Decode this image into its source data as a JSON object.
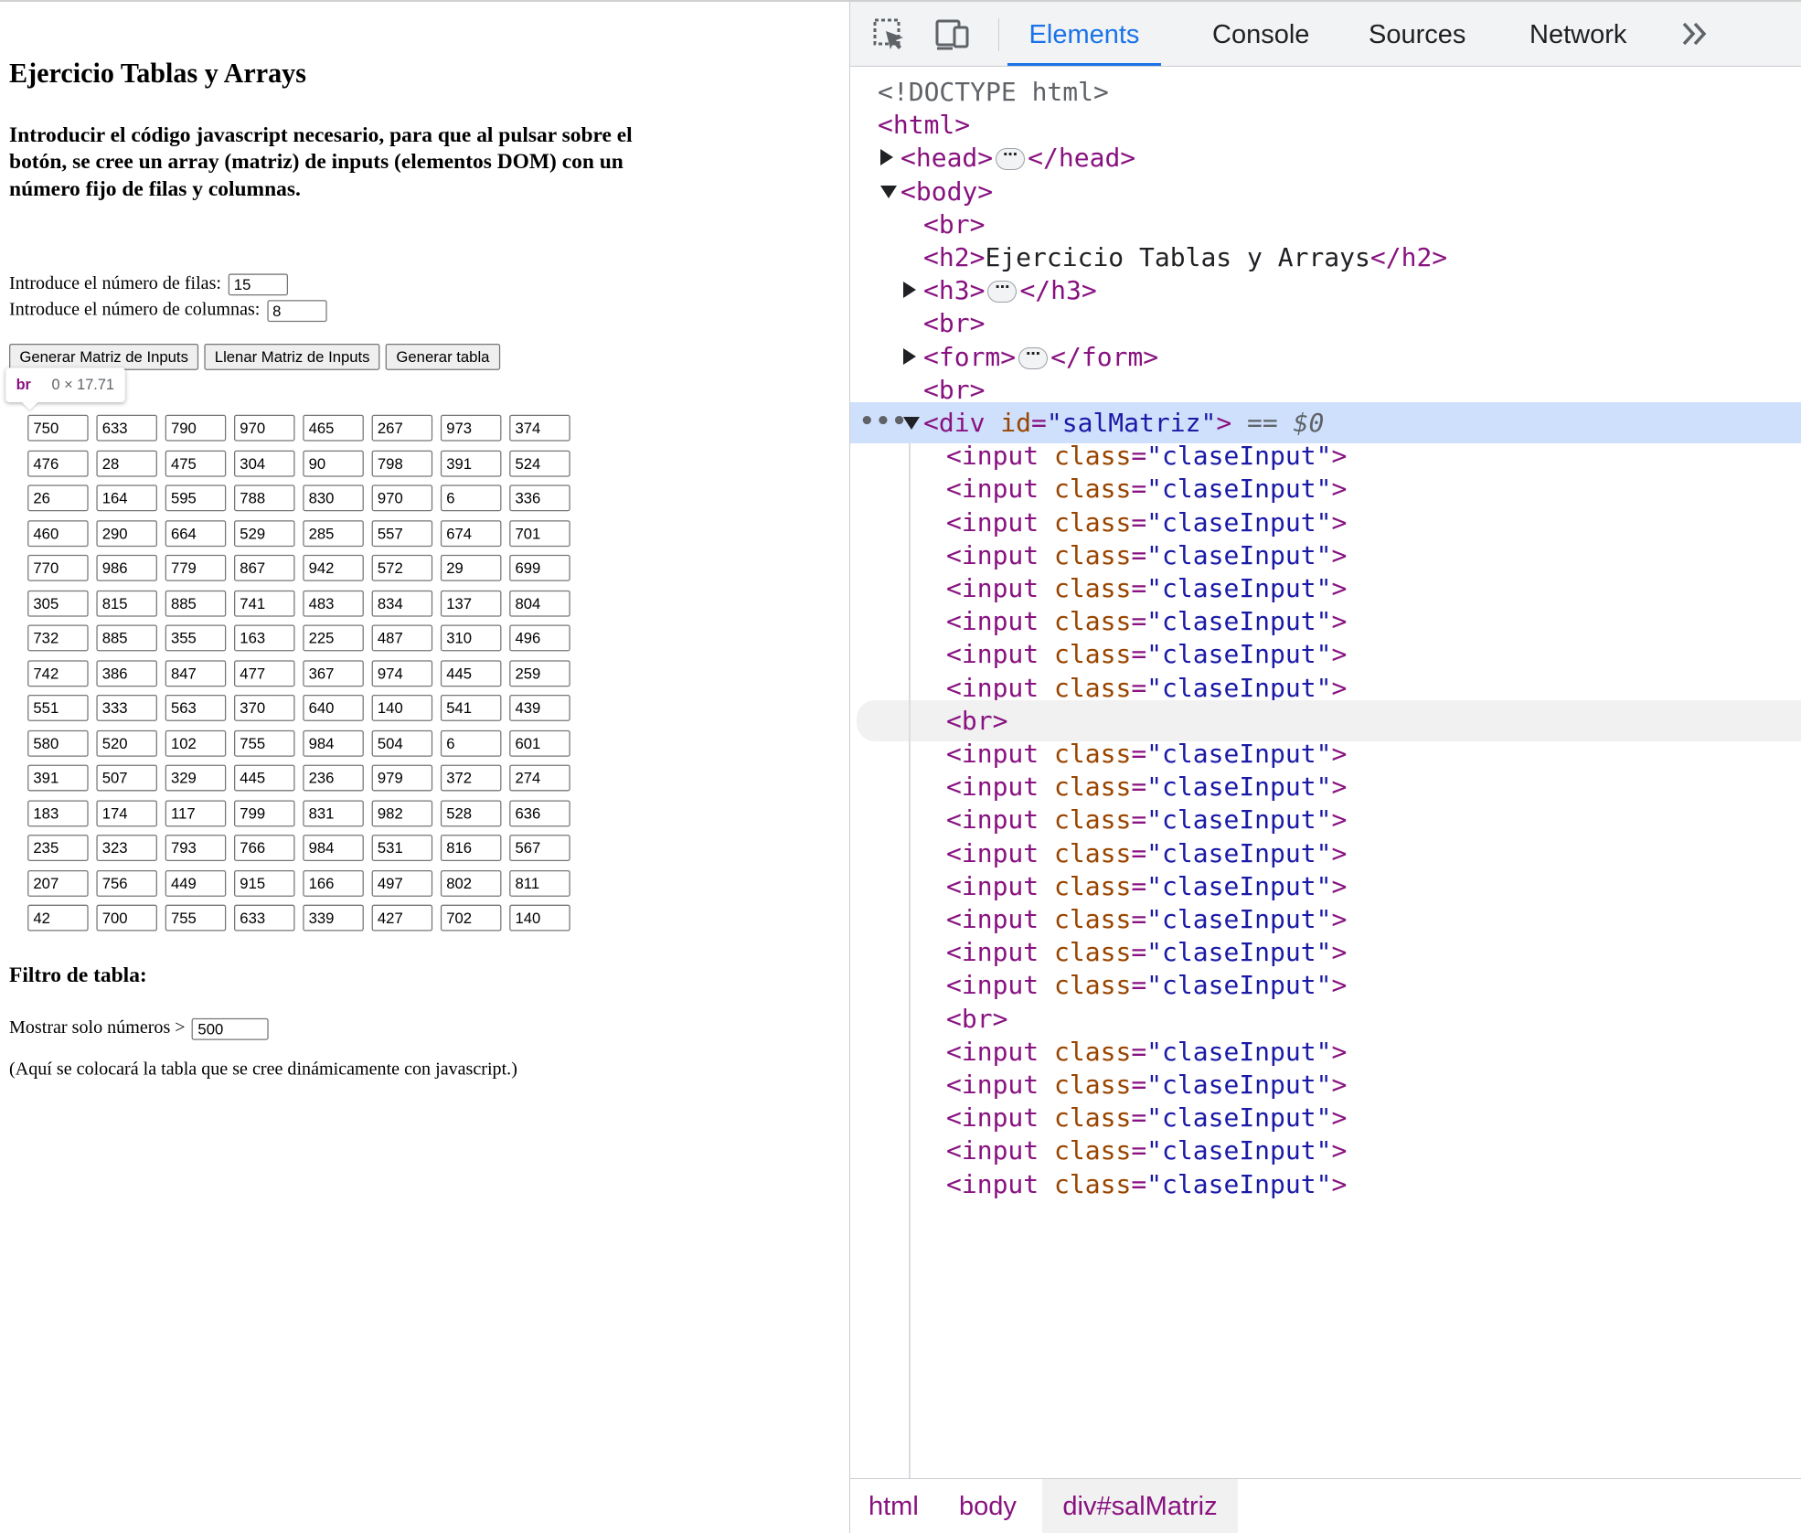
{
  "page": {
    "title": "Ejercicio Tablas y Arrays",
    "description": "Introducir el código javascript necesario, para que al pulsar sobre el botón, se cree un array (matriz) de inputs (elementos DOM) con un número fijo de filas y columnas.",
    "filas_label": "Introduce el número de filas:",
    "filas_value": "15",
    "columnas_label": "Introduce el número de columnas:",
    "columnas_value": "8",
    "buttons": {
      "generar_matriz": "Generar Matriz de Inputs",
      "llenar_matriz": "Llenar Matriz de Inputs",
      "generar_tabla": "Generar tabla"
    },
    "tooltip": {
      "tag": "br",
      "dims": "0 × 17.71"
    },
    "matrix": [
      [
        "750",
        "633",
        "790",
        "970",
        "465",
        "267",
        "973",
        "374"
      ],
      [
        "476",
        "28",
        "475",
        "304",
        "90",
        "798",
        "391",
        "524"
      ],
      [
        "26",
        "164",
        "595",
        "788",
        "830",
        "970",
        "6",
        "336"
      ],
      [
        "460",
        "290",
        "664",
        "529",
        "285",
        "557",
        "674",
        "701"
      ],
      [
        "770",
        "986",
        "779",
        "867",
        "942",
        "572",
        "29",
        "699"
      ],
      [
        "305",
        "815",
        "885",
        "741",
        "483",
        "834",
        "137",
        "804"
      ],
      [
        "732",
        "885",
        "355",
        "163",
        "225",
        "487",
        "310",
        "496"
      ],
      [
        "742",
        "386",
        "847",
        "477",
        "367",
        "974",
        "445",
        "259"
      ],
      [
        "551",
        "333",
        "563",
        "370",
        "640",
        "140",
        "541",
        "439"
      ],
      [
        "580",
        "520",
        "102",
        "755",
        "984",
        "504",
        "6",
        "601"
      ],
      [
        "391",
        "507",
        "329",
        "445",
        "236",
        "979",
        "372",
        "274"
      ],
      [
        "183",
        "174",
        "117",
        "799",
        "831",
        "982",
        "528",
        "636"
      ],
      [
        "235",
        "323",
        "793",
        "766",
        "984",
        "531",
        "816",
        "567"
      ],
      [
        "207",
        "756",
        "449",
        "915",
        "166",
        "497",
        "802",
        "811"
      ],
      [
        "42",
        "700",
        "755",
        "633",
        "339",
        "427",
        "702",
        "140"
      ]
    ],
    "filtro_heading": "Filtro de tabla:",
    "mostrar_label": "Mostrar solo números >",
    "mostrar_value": "500",
    "aqui_text": "(Aquí se colocará la tabla que se cree dinámicamente con javascript.)"
  },
  "devtools": {
    "tabs": [
      "Elements",
      "Console",
      "Sources",
      "Network"
    ],
    "active_tab": "Elements",
    "tree": [
      {
        "indent": 0,
        "toggle": "none",
        "html": "<span class='c-doc'>&lt;!DOCTYPE html&gt;</span>"
      },
      {
        "indent": 0,
        "toggle": "none",
        "html": "<span class='c-tag'>&lt;html&gt;</span>"
      },
      {
        "indent": 1,
        "toggle": "closed",
        "html": "<span class='c-tag'>&lt;head&gt;</span><span class='ellip'>⋯</span><span class='c-tag'>&lt;/head&gt;</span>"
      },
      {
        "indent": 1,
        "toggle": "open",
        "html": "<span class='c-tag'>&lt;body&gt;</span>"
      },
      {
        "indent": 2,
        "toggle": "none",
        "html": "<span class='c-tag'>&lt;br&gt;</span>"
      },
      {
        "indent": 2,
        "toggle": "none",
        "html": "<span class='c-tag'>&lt;h2&gt;</span><span class='c-text'>Ejercicio Tablas y Arrays</span><span class='c-tag'>&lt;/h2&gt;</span>"
      },
      {
        "indent": 2,
        "toggle": "closed",
        "html": "<span class='c-tag'>&lt;h3&gt;</span><span class='ellip'>⋯</span><span class='c-tag'>&lt;/h3&gt;</span>"
      },
      {
        "indent": 2,
        "toggle": "none",
        "html": "<span class='c-tag'>&lt;br&gt;</span>"
      },
      {
        "indent": 2,
        "toggle": "closed",
        "html": "<span class='c-tag'>&lt;form&gt;</span><span class='ellip'>⋯</span><span class='c-tag'>&lt;/form&gt;</span>"
      },
      {
        "indent": 2,
        "toggle": "none",
        "html": "<span class='c-tag'>&lt;br&gt;</span>"
      },
      {
        "indent": 2,
        "toggle": "open",
        "selected": true,
        "html": "<span class='c-tag'>&lt;div</span> <span class='c-attr'>id</span><span class='c-tag'>=</span><span class='c-val'>\"salMatriz\"</span><span class='c-tag'>&gt;</span> <span class='c-dollar'>== $0</span>"
      },
      {
        "indent": 3,
        "toggle": "none",
        "html": "<span class='c-tag'>&lt;input</span> <span class='c-attr'>class</span><span class='c-tag'>=</span><span class='c-val'>\"claseInput\"</span><span class='c-tag'>&gt;</span>"
      },
      {
        "indent": 3,
        "toggle": "none",
        "html": "<span class='c-tag'>&lt;input</span> <span class='c-attr'>class</span><span class='c-tag'>=</span><span class='c-val'>\"claseInput\"</span><span class='c-tag'>&gt;</span>"
      },
      {
        "indent": 3,
        "toggle": "none",
        "html": "<span class='c-tag'>&lt;input</span> <span class='c-attr'>class</span><span class='c-tag'>=</span><span class='c-val'>\"claseInput\"</span><span class='c-tag'>&gt;</span>"
      },
      {
        "indent": 3,
        "toggle": "none",
        "html": "<span class='c-tag'>&lt;input</span> <span class='c-attr'>class</span><span class='c-tag'>=</span><span class='c-val'>\"claseInput\"</span><span class='c-tag'>&gt;</span>"
      },
      {
        "indent": 3,
        "toggle": "none",
        "html": "<span class='c-tag'>&lt;input</span> <span class='c-attr'>class</span><span class='c-tag'>=</span><span class='c-val'>\"claseInput\"</span><span class='c-tag'>&gt;</span>"
      },
      {
        "indent": 3,
        "toggle": "none",
        "html": "<span class='c-tag'>&lt;input</span> <span class='c-attr'>class</span><span class='c-tag'>=</span><span class='c-val'>\"claseInput\"</span><span class='c-tag'>&gt;</span>"
      },
      {
        "indent": 3,
        "toggle": "none",
        "html": "<span class='c-tag'>&lt;input</span> <span class='c-attr'>class</span><span class='c-tag'>=</span><span class='c-val'>\"claseInput\"</span><span class='c-tag'>&gt;</span>"
      },
      {
        "indent": 3,
        "toggle": "none",
        "html": "<span class='c-tag'>&lt;input</span> <span class='c-attr'>class</span><span class='c-tag'>=</span><span class='c-val'>\"claseInput\"</span><span class='c-tag'>&gt;</span>"
      },
      {
        "indent": 3,
        "toggle": "none",
        "hover": true,
        "html": "<span class='c-tag'>&lt;br&gt;</span>"
      },
      {
        "indent": 3,
        "toggle": "none",
        "html": "<span class='c-tag'>&lt;input</span> <span class='c-attr'>class</span><span class='c-tag'>=</span><span class='c-val'>\"claseInput\"</span><span class='c-tag'>&gt;</span>"
      },
      {
        "indent": 3,
        "toggle": "none",
        "html": "<span class='c-tag'>&lt;input</span> <span class='c-attr'>class</span><span class='c-tag'>=</span><span class='c-val'>\"claseInput\"</span><span class='c-tag'>&gt;</span>"
      },
      {
        "indent": 3,
        "toggle": "none",
        "html": "<span class='c-tag'>&lt;input</span> <span class='c-attr'>class</span><span class='c-tag'>=</span><span class='c-val'>\"claseInput\"</span><span class='c-tag'>&gt;</span>"
      },
      {
        "indent": 3,
        "toggle": "none",
        "html": "<span class='c-tag'>&lt;input</span> <span class='c-attr'>class</span><span class='c-tag'>=</span><span class='c-val'>\"claseInput\"</span><span class='c-tag'>&gt;</span>"
      },
      {
        "indent": 3,
        "toggle": "none",
        "html": "<span class='c-tag'>&lt;input</span> <span class='c-attr'>class</span><span class='c-tag'>=</span><span class='c-val'>\"claseInput\"</span><span class='c-tag'>&gt;</span>"
      },
      {
        "indent": 3,
        "toggle": "none",
        "html": "<span class='c-tag'>&lt;input</span> <span class='c-attr'>class</span><span class='c-tag'>=</span><span class='c-val'>\"claseInput\"</span><span class='c-tag'>&gt;</span>"
      },
      {
        "indent": 3,
        "toggle": "none",
        "html": "<span class='c-tag'>&lt;input</span> <span class='c-attr'>class</span><span class='c-tag'>=</span><span class='c-val'>\"claseInput\"</span><span class='c-tag'>&gt;</span>"
      },
      {
        "indent": 3,
        "toggle": "none",
        "html": "<span class='c-tag'>&lt;input</span> <span class='c-attr'>class</span><span class='c-tag'>=</span><span class='c-val'>\"claseInput\"</span><span class='c-tag'>&gt;</span>"
      },
      {
        "indent": 3,
        "toggle": "none",
        "html": "<span class='c-tag'>&lt;br&gt;</span>"
      },
      {
        "indent": 3,
        "toggle": "none",
        "html": "<span class='c-tag'>&lt;input</span> <span class='c-attr'>class</span><span class='c-tag'>=</span><span class='c-val'>\"claseInput\"</span><span class='c-tag'>&gt;</span>"
      },
      {
        "indent": 3,
        "toggle": "none",
        "html": "<span class='c-tag'>&lt;input</span> <span class='c-attr'>class</span><span class='c-tag'>=</span><span class='c-val'>\"claseInput\"</span><span class='c-tag'>&gt;</span>"
      },
      {
        "indent": 3,
        "toggle": "none",
        "html": "<span class='c-tag'>&lt;input</span> <span class='c-attr'>class</span><span class='c-tag'>=</span><span class='c-val'>\"claseInput\"</span><span class='c-tag'>&gt;</span>"
      },
      {
        "indent": 3,
        "toggle": "none",
        "html": "<span class='c-tag'>&lt;input</span> <span class='c-attr'>class</span><span class='c-tag'>=</span><span class='c-val'>\"claseInput\"</span><span class='c-tag'>&gt;</span>"
      },
      {
        "indent": 3,
        "toggle": "none",
        "html": "<span class='c-tag'>&lt;input</span> <span class='c-attr'>class</span><span class='c-tag'>=</span><span class='c-val'>\"claseInput\"</span><span class='c-tag'>&gt;</span>"
      }
    ],
    "breadcrumbs": [
      "html",
      "body",
      "div#salMatriz"
    ]
  }
}
